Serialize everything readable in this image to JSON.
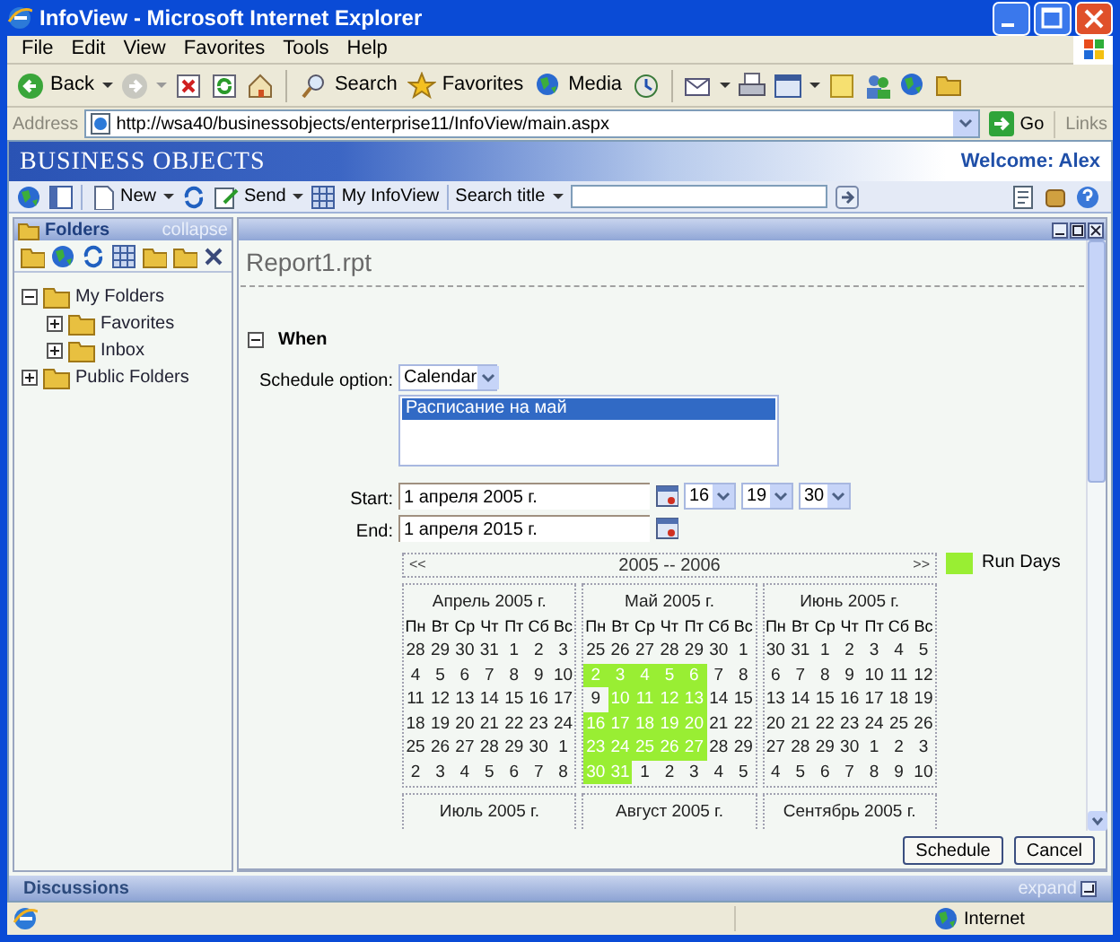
{
  "window": {
    "title": "InfoView - Microsoft Internet Explorer"
  },
  "menu": [
    "File",
    "Edit",
    "View",
    "Favorites",
    "Tools",
    "Help"
  ],
  "toolbar": {
    "back": "Back",
    "search": "Search",
    "favorites": "Favorites",
    "media": "Media"
  },
  "address": {
    "label": "Address",
    "url": "http://wsa40/businessobjects/enterprise11/InfoView/main.aspx",
    "go": "Go",
    "links": "Links"
  },
  "banner": {
    "logo": "BUSINESS OBJECTS",
    "welcome": "Welcome: Alex"
  },
  "app_toolbar": {
    "new": "New",
    "send": "Send",
    "my_infoview": "My InfoView",
    "search_menu": "Search title"
  },
  "folders": {
    "title": "Folders",
    "collapse": "collapse",
    "tree": [
      {
        "label": "My Folders",
        "expanded": true,
        "children": [
          {
            "label": "Favorites",
            "expanded": false
          },
          {
            "label": "Inbox",
            "expanded": false
          }
        ]
      },
      {
        "label": "Public Folders",
        "expanded": false
      }
    ]
  },
  "report": {
    "title": "Report1.rpt",
    "section": {
      "label": "When",
      "expanded": true
    },
    "schedule_option_label": "Schedule option:",
    "schedule_option": "Calendar",
    "calendars": [
      {
        "label": "Расписание на май",
        "selected": true
      }
    ],
    "start_label": "Start:",
    "start": "1 апреля 2005 г.",
    "hour": "16",
    "minute": "19",
    "second": "30",
    "end_label": "End:",
    "end": "1 апреля 2015 г.",
    "calendar": {
      "prev": "<<",
      "range": "2005 -- 2006",
      "next": ">>",
      "months": [
        {
          "title": "Апрель 2005 г.",
          "weekdays": [
            "Пн",
            "Вт",
            "Ср",
            "Чт",
            "Пт",
            "Сб",
            "Вс"
          ],
          "weeks": [
            [
              {
                "day": "28",
                "run_day": false
              },
              {
                "day": "29",
                "run_day": false
              },
              {
                "day": "30",
                "run_day": false
              },
              {
                "day": "31",
                "run_day": false
              },
              {
                "day": "1",
                "run_day": false
              },
              {
                "day": "2",
                "run_day": false
              },
              {
                "day": "3",
                "run_day": false
              }
            ],
            [
              {
                "day": "4",
                "run_day": false
              },
              {
                "day": "5",
                "run_day": false
              },
              {
                "day": "6",
                "run_day": false
              },
              {
                "day": "7",
                "run_day": false
              },
              {
                "day": "8",
                "run_day": false
              },
              {
                "day": "9",
                "run_day": false
              },
              {
                "day": "10",
                "run_day": false
              }
            ],
            [
              {
                "day": "11",
                "run_day": false
              },
              {
                "day": "12",
                "run_day": false
              },
              {
                "day": "13",
                "run_day": false
              },
              {
                "day": "14",
                "run_day": false
              },
              {
                "day": "15",
                "run_day": false
              },
              {
                "day": "16",
                "run_day": false
              },
              {
                "day": "17",
                "run_day": false
              }
            ],
            [
              {
                "day": "18",
                "run_day": false
              },
              {
                "day": "19",
                "run_day": false
              },
              {
                "day": "20",
                "run_day": false
              },
              {
                "day": "21",
                "run_day": false
              },
              {
                "day": "22",
                "run_day": false
              },
              {
                "day": "23",
                "run_day": false
              },
              {
                "day": "24",
                "run_day": false
              }
            ],
            [
              {
                "day": "25",
                "run_day": false
              },
              {
                "day": "26",
                "run_day": false
              },
              {
                "day": "27",
                "run_day": false
              },
              {
                "day": "28",
                "run_day": false
              },
              {
                "day": "29",
                "run_day": false
              },
              {
                "day": "30",
                "run_day": false
              },
              {
                "day": "1",
                "run_day": false
              }
            ],
            [
              {
                "day": "2",
                "run_day": false
              },
              {
                "day": "3",
                "run_day": false
              },
              {
                "day": "4",
                "run_day": false
              },
              {
                "day": "5",
                "run_day": false
              },
              {
                "day": "6",
                "run_day": false
              },
              {
                "day": "7",
                "run_day": false
              },
              {
                "day": "8",
                "run_day": false
              }
            ]
          ]
        },
        {
          "title": "Май 2005 г.",
          "weekdays": [
            "Пн",
            "Вт",
            "Ср",
            "Чт",
            "Пт",
            "Сб",
            "Вс"
          ],
          "weeks": [
            [
              {
                "day": "25",
                "run_day": false
              },
              {
                "day": "26",
                "run_day": false
              },
              {
                "day": "27",
                "run_day": false
              },
              {
                "day": "28",
                "run_day": false
              },
              {
                "day": "29",
                "run_day": false
              },
              {
                "day": "30",
                "run_day": false
              },
              {
                "day": "1",
                "run_day": false
              }
            ],
            [
              {
                "day": "2",
                "run_day": true
              },
              {
                "day": "3",
                "run_day": true
              },
              {
                "day": "4",
                "run_day": true
              },
              {
                "day": "5",
                "run_day": true
              },
              {
                "day": "6",
                "run_day": true
              },
              {
                "day": "7",
                "run_day": false
              },
              {
                "day": "8",
                "run_day": false
              }
            ],
            [
              {
                "day": "9",
                "run_day": false
              },
              {
                "day": "10",
                "run_day": true
              },
              {
                "day": "11",
                "run_day": true
              },
              {
                "day": "12",
                "run_day": true
              },
              {
                "day": "13",
                "run_day": true
              },
              {
                "day": "14",
                "run_day": false
              },
              {
                "day": "15",
                "run_day": false
              }
            ],
            [
              {
                "day": "16",
                "run_day": true
              },
              {
                "day": "17",
                "run_day": true
              },
              {
                "day": "18",
                "run_day": true
              },
              {
                "day": "19",
                "run_day": true
              },
              {
                "day": "20",
                "run_day": true
              },
              {
                "day": "21",
                "run_day": false
              },
              {
                "day": "22",
                "run_day": false
              }
            ],
            [
              {
                "day": "23",
                "run_day": true
              },
              {
                "day": "24",
                "run_day": true
              },
              {
                "day": "25",
                "run_day": true
              },
              {
                "day": "26",
                "run_day": true
              },
              {
                "day": "27",
                "run_day": true
              },
              {
                "day": "28",
                "run_day": false
              },
              {
                "day": "29",
                "run_day": false
              }
            ],
            [
              {
                "day": "30",
                "run_day": true
              },
              {
                "day": "31",
                "run_day": true
              },
              {
                "day": "1",
                "run_day": false
              },
              {
                "day": "2",
                "run_day": false
              },
              {
                "day": "3",
                "run_day": false
              },
              {
                "day": "4",
                "run_day": false
              },
              {
                "day": "5",
                "run_day": false
              }
            ]
          ]
        },
        {
          "title": "Июнь 2005 г.",
          "weekdays": [
            "Пн",
            "Вт",
            "Ср",
            "Чт",
            "Пт",
            "Сб",
            "Вс"
          ],
          "weeks": [
            [
              {
                "day": "30",
                "run_day": false
              },
              {
                "day": "31",
                "run_day": false
              },
              {
                "day": "1",
                "run_day": false
              },
              {
                "day": "2",
                "run_day": false
              },
              {
                "day": "3",
                "run_day": false
              },
              {
                "day": "4",
                "run_day": false
              },
              {
                "day": "5",
                "run_day": false
              }
            ],
            [
              {
                "day": "6",
                "run_day": false
              },
              {
                "day": "7",
                "run_day": false
              },
              {
                "day": "8",
                "run_day": false
              },
              {
                "day": "9",
                "run_day": false
              },
              {
                "day": "10",
                "run_day": false
              },
              {
                "day": "11",
                "run_day": false
              },
              {
                "day": "12",
                "run_day": false
              }
            ],
            [
              {
                "day": "13",
                "run_day": false
              },
              {
                "day": "14",
                "run_day": false
              },
              {
                "day": "15",
                "run_day": false
              },
              {
                "day": "16",
                "run_day": false
              },
              {
                "day": "17",
                "run_day": false
              },
              {
                "day": "18",
                "run_day": false
              },
              {
                "day": "19",
                "run_day": false
              }
            ],
            [
              {
                "day": "20",
                "run_day": false
              },
              {
                "day": "21",
                "run_day": false
              },
              {
                "day": "22",
                "run_day": false
              },
              {
                "day": "23",
                "run_day": false
              },
              {
                "day": "24",
                "run_day": false
              },
              {
                "day": "25",
                "run_day": false
              },
              {
                "day": "26",
                "run_day": false
              }
            ],
            [
              {
                "day": "27",
                "run_day": false
              },
              {
                "day": "28",
                "run_day": false
              },
              {
                "day": "29",
                "run_day": false
              },
              {
                "day": "30",
                "run_day": false
              },
              {
                "day": "1",
                "run_day": false
              },
              {
                "day": "2",
                "run_day": false
              },
              {
                "day": "3",
                "run_day": false
              }
            ],
            [
              {
                "day": "4",
                "run_day": false
              },
              {
                "day": "5",
                "run_day": false
              },
              {
                "day": "6",
                "run_day": false
              },
              {
                "day": "7",
                "run_day": false
              },
              {
                "day": "8",
                "run_day": false
              },
              {
                "day": "9",
                "run_day": false
              },
              {
                "day": "10",
                "run_day": false
              }
            ]
          ]
        },
        {
          "title": "Июль 2005 г."
        },
        {
          "title": "Август 2005 г."
        },
        {
          "title": "Сентябрь 2005 г."
        }
      ]
    },
    "legend": {
      "label": "Run Days",
      "color": "#99ee33"
    }
  },
  "buttons": [
    "Schedule",
    "Cancel"
  ],
  "discussions": {
    "title": "Discussions",
    "expand": "expand"
  },
  "status_bar": {
    "zone": "Internet"
  }
}
